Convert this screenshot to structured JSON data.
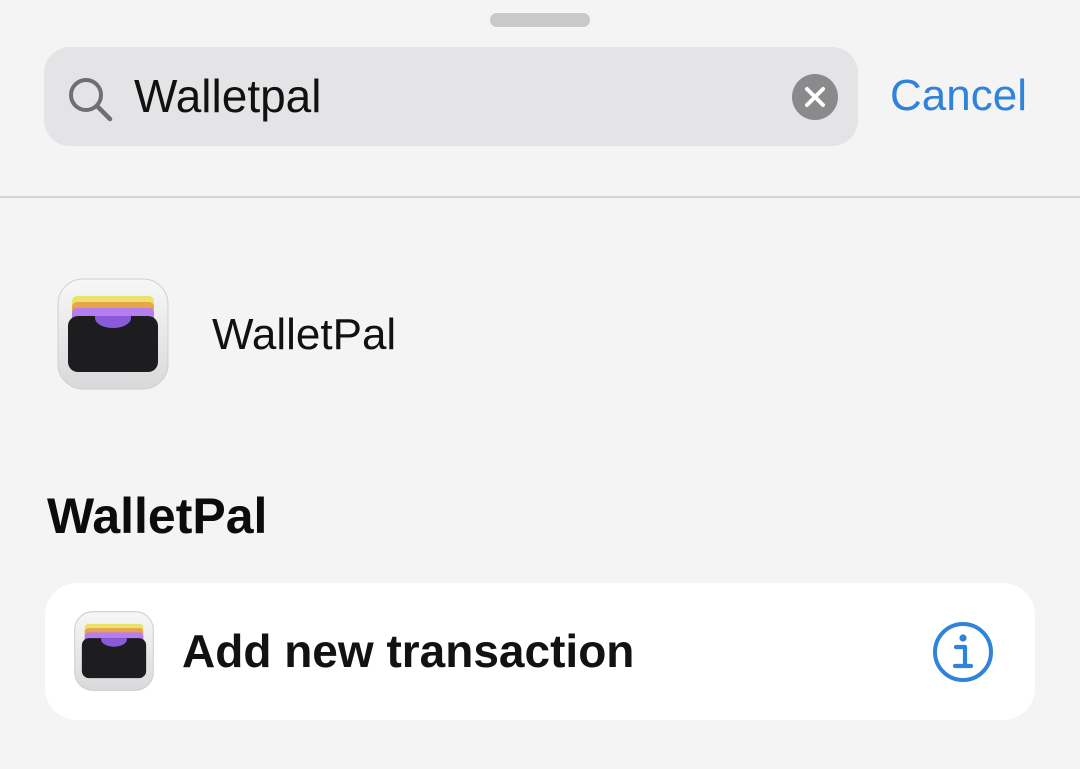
{
  "search": {
    "query": "Walletpal",
    "cancel_label": "Cancel"
  },
  "app_result": {
    "name": "WalletPal",
    "icon": "walletpal-app-icon"
  },
  "section": {
    "title": "WalletPal"
  },
  "actions": [
    {
      "label": "Add new transaction",
      "icon": "walletpal-app-icon",
      "info_icon": "info-icon"
    }
  ],
  "colors": {
    "accent": "#2f83da",
    "background": "#f4f4f5",
    "search_field": "#e4e4e6",
    "card": "#ffffff"
  }
}
